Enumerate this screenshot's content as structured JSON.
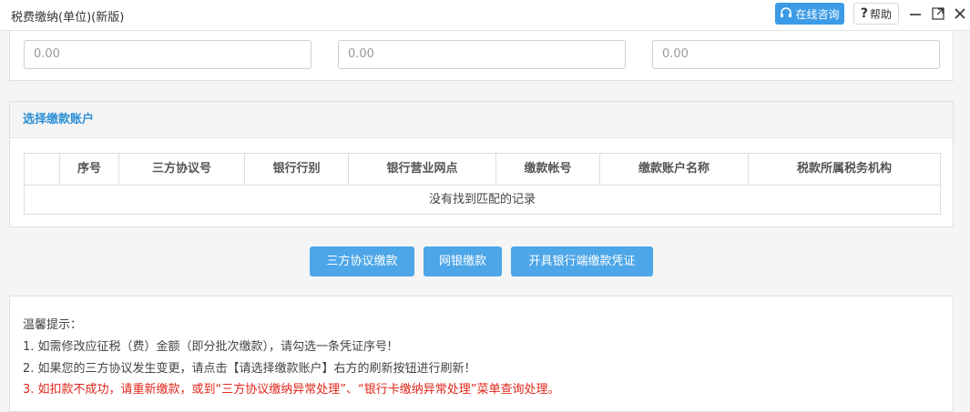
{
  "window": {
    "title": "税费缴纳(单位)(新版)",
    "consult_label": "在线咨询",
    "help_label": "帮助",
    "help_glyph": "?"
  },
  "amounts": [
    "0.00",
    "0.00",
    "0.00"
  ],
  "account_panel": {
    "title": "选择缴款账户",
    "columns": [
      "序号",
      "三方协议号",
      "银行行别",
      "银行营业网点",
      "缴款帐号",
      "缴款账户名称",
      "税款所属税务机构"
    ],
    "empty_message": "没有找到匹配的记录"
  },
  "actions": {
    "tripartite_pay": "三方协议缴款",
    "online_bank_pay": "网银缴款",
    "bank_voucher": "开具银行端缴款凭证"
  },
  "tips": {
    "heading": "温馨提示：",
    "line1": "1. 如需修改应征税（费）金额（即分批次缴款），请勾选一条凭证序号!",
    "line2": "2. 如果您的三方协议发生变更，请点击【请选择缴款账户】右方的刷新按钮进行刷新！",
    "line3": "3. 如扣款不成功，请重新缴款，或到“三方协议缴纳异常处理”、“银行卡缴纳异常处理”菜单查询处理。"
  },
  "colors": {
    "accent": "#3c9be6",
    "button": "#4da6e8",
    "panel_title": "#2b8ed4",
    "warning": "#e0261b"
  }
}
